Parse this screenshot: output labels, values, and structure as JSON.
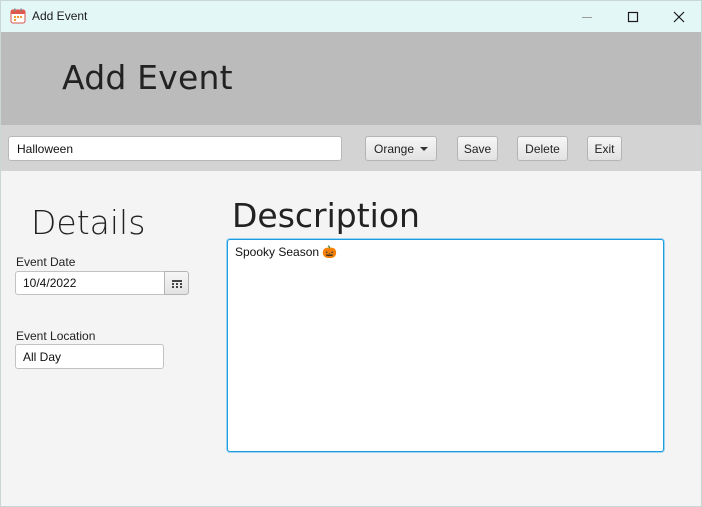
{
  "window": {
    "title": "Add Event",
    "icon": "calendar-icon"
  },
  "header": {
    "title": "Add Event"
  },
  "toolbar": {
    "event_name": "Halloween",
    "color": "Orange",
    "save_label": "Save",
    "delete_label": "Delete",
    "exit_label": "Exit"
  },
  "details": {
    "title": "Details",
    "date_label": "Event Date",
    "date_value": "10/4/2022",
    "location_label": "Event Location",
    "location_value": "All Day"
  },
  "description": {
    "title": "Description",
    "text": "Spooky Season 🎃"
  }
}
